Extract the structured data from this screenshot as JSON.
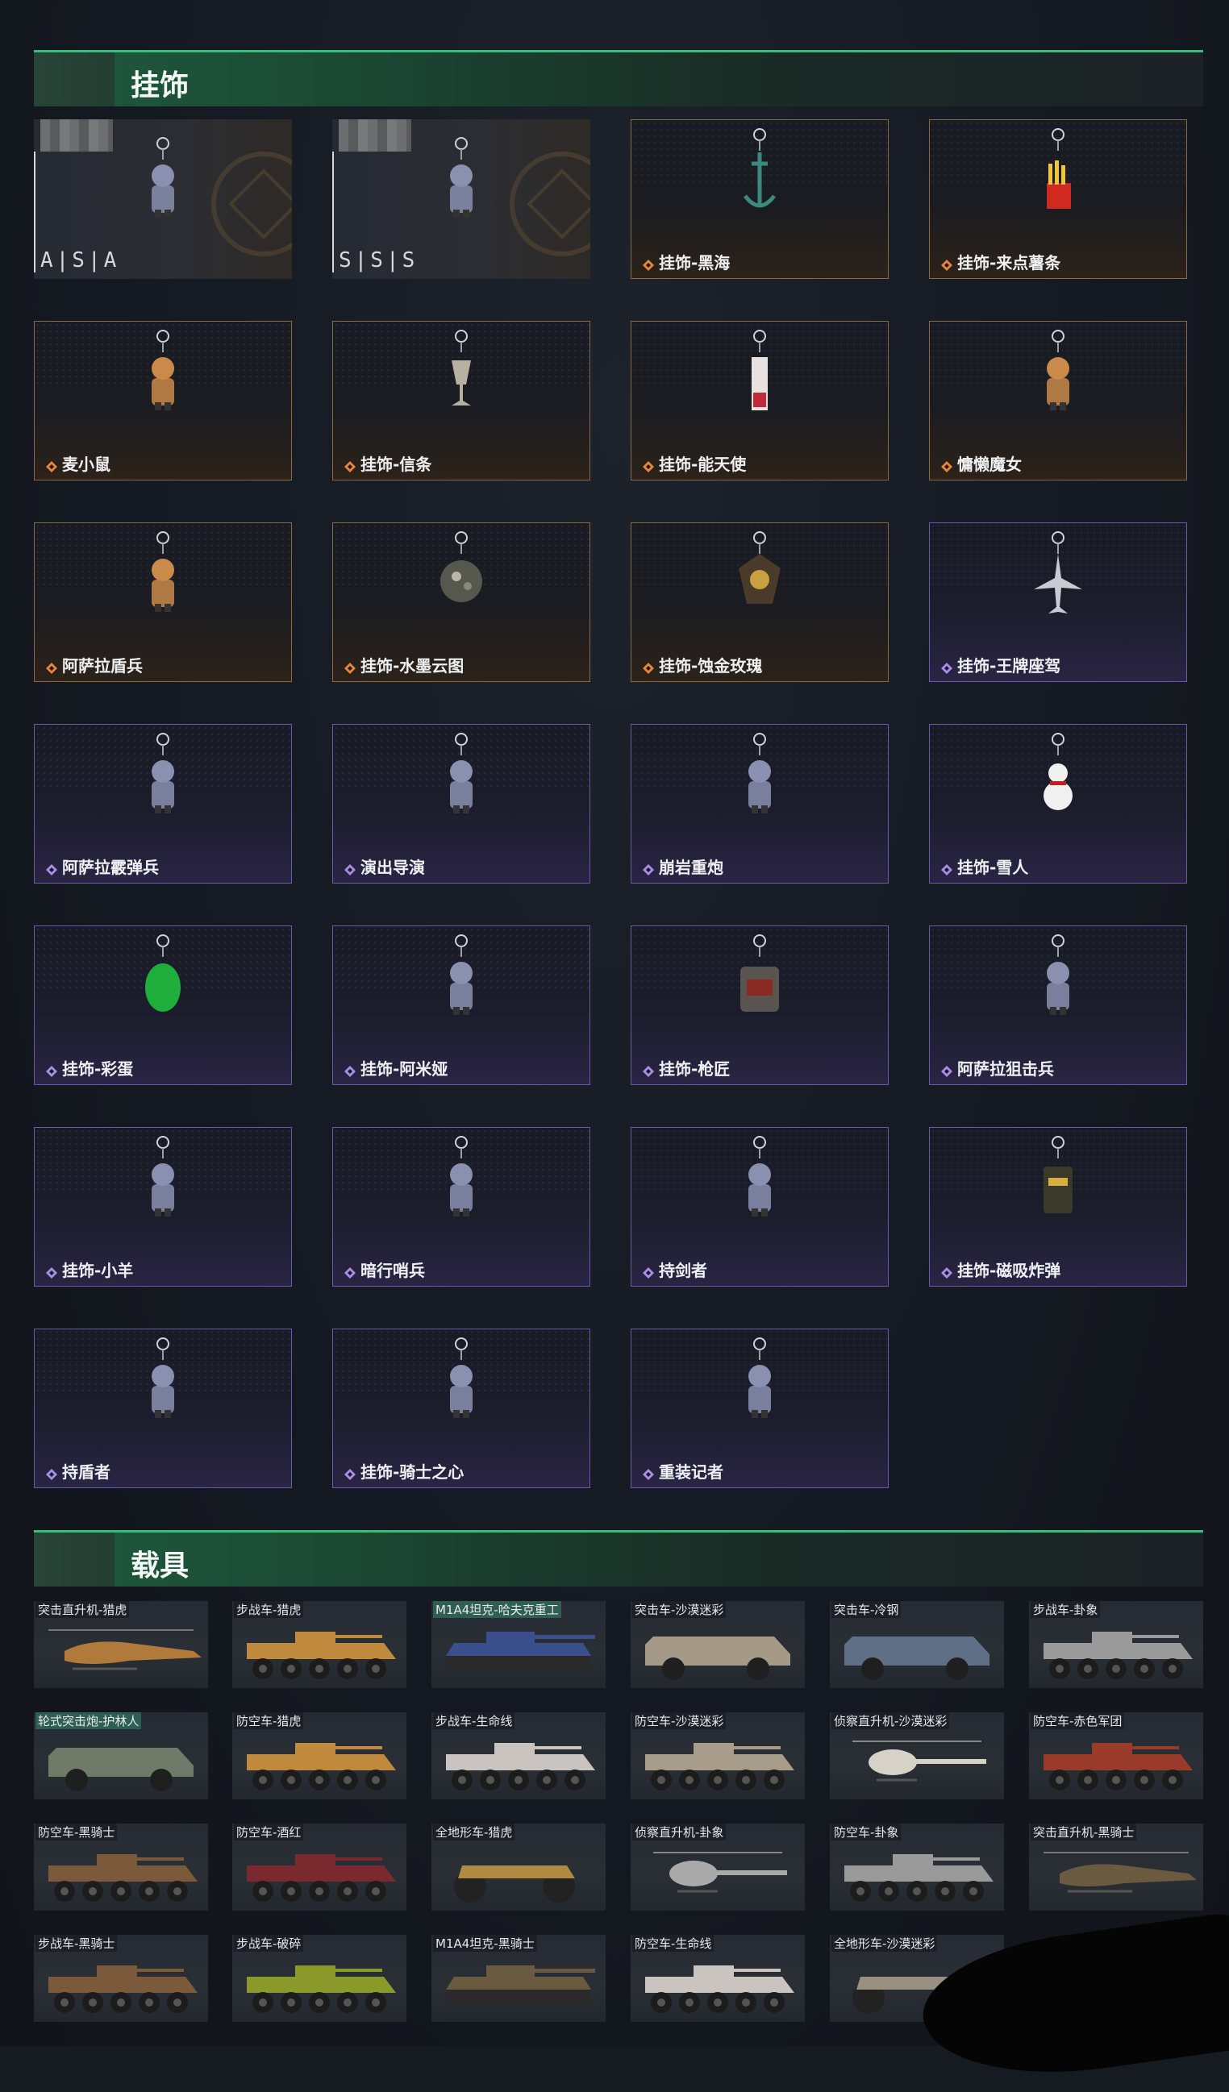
{
  "sections": {
    "charms_title": "挂饰",
    "vehicles_title": "载具"
  },
  "special_cards": [
    {
      "grade": "A|S|A"
    },
    {
      "grade": "S|S|S"
    }
  ],
  "charms": [
    {
      "label": "挂饰-黑海",
      "rarity": "orange",
      "icon": "anchor-charm-icon"
    },
    {
      "label": "挂饰-来点薯条",
      "rarity": "orange",
      "icon": "fries-charm-icon"
    },
    {
      "label": "麦小鼠",
      "rarity": "orange",
      "icon": "mouse-charm-icon"
    },
    {
      "label": "挂饰-信条",
      "rarity": "orange",
      "icon": "goblet-charm-icon"
    },
    {
      "label": "挂饰-能天使",
      "rarity": "orange",
      "icon": "tag-charm-icon"
    },
    {
      "label": "慵懒魔女",
      "rarity": "orange",
      "icon": "witch-charm-icon"
    },
    {
      "label": "阿萨拉盾兵",
      "rarity": "orange",
      "icon": "shield-soldier-charm-icon"
    },
    {
      "label": "挂饰-水墨云图",
      "rarity": "orange",
      "icon": "ball-charm-icon"
    },
    {
      "label": "挂饰-蚀金玫瑰",
      "rarity": "orange",
      "icon": "rose-badge-charm-icon"
    },
    {
      "label": "挂饰-王牌座驾",
      "rarity": "purple",
      "icon": "jet-charm-icon"
    },
    {
      "label": "阿萨拉霰弹兵",
      "rarity": "purple",
      "icon": "shotgunner-charm-icon"
    },
    {
      "label": "演出导演",
      "rarity": "purple",
      "icon": "director-charm-icon"
    },
    {
      "label": "崩岩重炮",
      "rarity": "purple",
      "icon": "heavy-gunner-charm-icon"
    },
    {
      "label": "挂饰-雪人",
      "rarity": "purple",
      "icon": "snowman-charm-icon"
    },
    {
      "label": "挂饰-彩蛋",
      "rarity": "purple",
      "icon": "egg-charm-icon"
    },
    {
      "label": "挂饰-阿米娅",
      "rarity": "purple",
      "icon": "bunny-charm-icon"
    },
    {
      "label": "挂饰-枪匠",
      "rarity": "purple",
      "icon": "backpack-charm-icon"
    },
    {
      "label": "阿萨拉狙击兵",
      "rarity": "purple",
      "icon": "sniper-charm-icon"
    },
    {
      "label": "挂饰-小羊",
      "rarity": "purple",
      "icon": "sheep-charm-icon"
    },
    {
      "label": "暗行哨兵",
      "rarity": "purple",
      "icon": "sentinel-charm-icon"
    },
    {
      "label": "持剑者",
      "rarity": "purple",
      "icon": "swordsman-charm-icon"
    },
    {
      "label": "挂饰-磁吸炸弹",
      "rarity": "purple",
      "icon": "bomb-charm-icon"
    },
    {
      "label": "持盾者",
      "rarity": "purple",
      "icon": "shieldbearer-charm-icon"
    },
    {
      "label": "挂饰-骑士之心",
      "rarity": "purple",
      "icon": "knight-heart-charm-icon"
    },
    {
      "label": "重装记者",
      "rarity": "purple",
      "icon": "reporter-charm-icon"
    }
  ],
  "vehicles": [
    {
      "label": "突击直升机-猎虎",
      "kind": "heli",
      "color": "#b07a3a"
    },
    {
      "label": "步战车-猎虎",
      "kind": "apc",
      "color": "#c08a3e"
    },
    {
      "label": "M1A4坦克-哈夫克重工",
      "kind": "tank",
      "color": "#3a4f8c",
      "hl": true
    },
    {
      "label": "突击车-沙漠迷彩",
      "kind": "truck",
      "color": "#a59a88"
    },
    {
      "label": "突击车-冷钢",
      "kind": "truck",
      "color": "#5f6f86"
    },
    {
      "label": "步战车-卦象",
      "kind": "apc",
      "color": "#9a9a9a"
    },
    {
      "label": "轮式突击炮-护林人",
      "kind": "truck",
      "color": "#6f7a68",
      "hl": true
    },
    {
      "label": "防空车-猎虎",
      "kind": "apc",
      "color": "#c08a3e"
    },
    {
      "label": "步战车-生命线",
      "kind": "apc",
      "color": "#c9c4c0"
    },
    {
      "label": "防空车-沙漠迷彩",
      "kind": "apc",
      "color": "#a89c8a"
    },
    {
      "label": "侦察直升机-沙漠迷彩",
      "kind": "scout",
      "color": "#d6d2c8"
    },
    {
      "label": "防空车-赤色军团",
      "kind": "apc",
      "color": "#9a3a2a"
    },
    {
      "label": "防空车-黑骑士",
      "kind": "apc",
      "color": "#7a5a3a"
    },
    {
      "label": "防空车-酒红",
      "kind": "apc",
      "color": "#7a2a2e"
    },
    {
      "label": "全地形车-猎虎",
      "kind": "atv",
      "color": "#b08a40"
    },
    {
      "label": "侦察直升机-卦象",
      "kind": "scout",
      "color": "#aaaaaa"
    },
    {
      "label": "防空车-卦象",
      "kind": "apc",
      "color": "#9a9a9a"
    },
    {
      "label": "突击直升机-黑骑士",
      "kind": "heli",
      "color": "#6a5a40"
    },
    {
      "label": "步战车-黑骑士",
      "kind": "apc",
      "color": "#7a5a3a"
    },
    {
      "label": "步战车-破碎",
      "kind": "apc",
      "color": "#8a9a2a"
    },
    {
      "label": "M1A4坦克-黑骑士",
      "kind": "tank",
      "color": "#6a5a40"
    },
    {
      "label": "防空车-生命线",
      "kind": "apc",
      "color": "#c9c4c0"
    },
    {
      "label": "全地形车-沙漠迷彩",
      "kind": "atv",
      "color": "#9a9080"
    }
  ]
}
